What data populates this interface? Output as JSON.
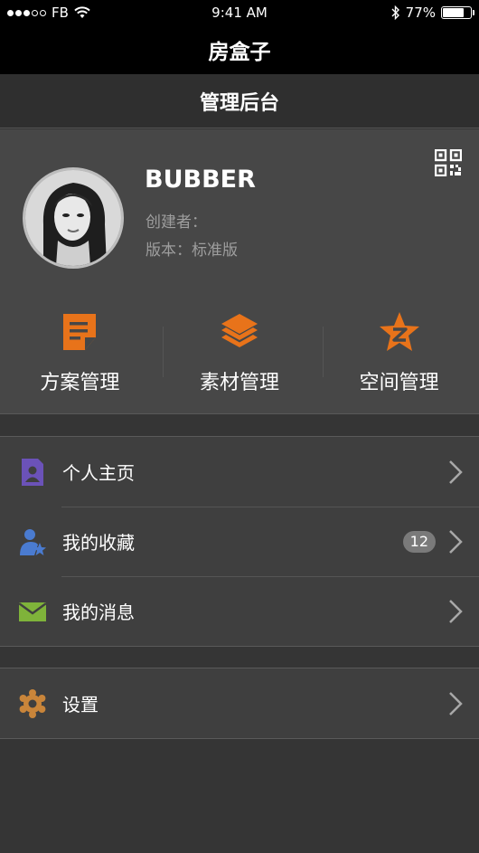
{
  "status_bar": {
    "carrier": "FB",
    "time": "9:41 AM",
    "battery_percent": "77%",
    "battery_level": 0.77
  },
  "app": {
    "title": "房盒子"
  },
  "page": {
    "title": "管理后台"
  },
  "profile": {
    "name": "BUBBER",
    "creator_label": "创建者：",
    "version_label": "版本：标准版"
  },
  "quick_actions": [
    {
      "label": "方案管理",
      "icon": "document-edit-icon",
      "color": "#e8731a"
    },
    {
      "label": "素材管理",
      "icon": "layers-icon",
      "color": "#e8731a"
    },
    {
      "label": "空间管理",
      "icon": "star-badge-icon",
      "color": "#e8731a"
    }
  ],
  "menu": {
    "personal_home": {
      "label": "个人主页",
      "icon": "profile-document-icon",
      "color": "#6b52b8"
    },
    "favorites": {
      "label": "我的收藏",
      "icon": "user-star-icon",
      "color": "#4a7bd0",
      "badge": "12"
    },
    "messages": {
      "label": "我的消息",
      "icon": "mail-icon",
      "color": "#7fb33a"
    },
    "settings": {
      "label": "设置",
      "icon": "gear-icon",
      "color": "#c9853a"
    }
  }
}
